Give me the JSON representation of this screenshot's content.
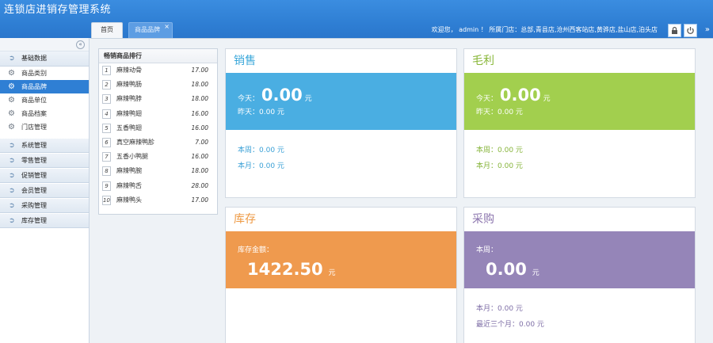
{
  "app": {
    "title": "连锁店进销存管理系统"
  },
  "tabs": [
    {
      "label": "首页"
    },
    {
      "label": "商品品牌",
      "close": "×"
    }
  ],
  "header": {
    "welcome": "欢迎您， admin ！ 所属门店：总部,青县店,沧州西客站店,黄骅店,盐山店,泊头店",
    "collapse_glyph": "»"
  },
  "sidebar": {
    "collapse_glyph": "«",
    "groups": [
      {
        "label": "基础数据",
        "items": [
          {
            "label": "商品类别"
          },
          {
            "label": "商品品牌"
          },
          {
            "label": "商品单位"
          },
          {
            "label": "商品档案"
          },
          {
            "label": "门店管理"
          }
        ]
      },
      {
        "label": "系统管理"
      },
      {
        "label": "零售管理"
      },
      {
        "label": "促销管理"
      },
      {
        "label": "会员管理"
      },
      {
        "label": "采购管理"
      },
      {
        "label": "库存管理"
      }
    ],
    "active_item": "商品品牌"
  },
  "ranking": {
    "title": "畅销商品排行",
    "rows": [
      {
        "rank": "1",
        "name": "麻辣动骨",
        "value": "17.00"
      },
      {
        "rank": "2",
        "name": "麻辣鸭肠",
        "value": "18.00"
      },
      {
        "rank": "3",
        "name": "麻辣鸭脖",
        "value": "18.00"
      },
      {
        "rank": "4",
        "name": "麻辣鸭翅",
        "value": "16.00"
      },
      {
        "rank": "5",
        "name": "五香鸭翅",
        "value": "16.00"
      },
      {
        "rank": "6",
        "name": "真空麻辣鸭胗",
        "value": "7.00"
      },
      {
        "rank": "7",
        "name": "五香小鸭腿",
        "value": "16.00"
      },
      {
        "rank": "8",
        "name": "麻辣鸭腕",
        "value": "18.00"
      },
      {
        "rank": "9",
        "name": "麻辣鸭舌",
        "value": "28.00"
      },
      {
        "rank": "10",
        "name": "麻辣鸭头",
        "value": "17.00"
      }
    ]
  },
  "cards": {
    "sales": {
      "title": "销售",
      "today_label": "今天：",
      "today_value": "0.00",
      "unit": "元",
      "yesterday": "昨天：0.00 元",
      "week": "本周：0.00 元",
      "month": "本月：0.00 元"
    },
    "profit": {
      "title": "毛利",
      "today_label": "今天：",
      "today_value": "0.00",
      "unit": "元",
      "yesterday": "昨天：0.00 元",
      "week": "本周：0.00 元",
      "month": "本月：0.00 元"
    },
    "stock": {
      "title": "库存",
      "amount_label": "库存金额：",
      "amount_value": "1422.50",
      "unit": "元"
    },
    "purchase": {
      "title": "采购",
      "week_label": "本周：",
      "week_value": "0.00",
      "unit": "元",
      "month": "本月：0.00 元",
      "three_months": "最近三个月：0.00 元"
    }
  },
  "colors": {
    "header": "#2f7fd4",
    "sales": "#4aaee2",
    "profit": "#a2cf4e",
    "stock": "#ef9a4e",
    "purchase": "#9585b8"
  },
  "icons": {
    "lock": "lock-icon",
    "power": "power-icon",
    "gear": "gear-icon"
  }
}
